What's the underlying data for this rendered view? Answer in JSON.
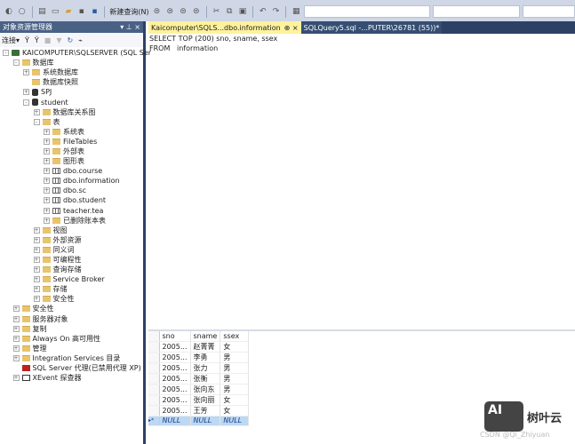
{
  "toolbar": {
    "new_query": "新建查询(N)"
  },
  "object_explorer": {
    "title": "对象资源管理器",
    "pin": "▾ ⊥ ×",
    "connect": "连接▾"
  },
  "tree": [
    {
      "label": "KAICOMPUTER\\SQLSERVER (SQL Ser",
      "level": 0,
      "exp": "-",
      "icon": "srv"
    },
    {
      "label": "数据库",
      "level": 1,
      "exp": "-",
      "icon": "folder"
    },
    {
      "label": "系统数据库",
      "level": 2,
      "exp": "+",
      "icon": "folder"
    },
    {
      "label": "数据库快照",
      "level": 2,
      "exp": "",
      "icon": "folder"
    },
    {
      "label": "SPJ",
      "level": 2,
      "exp": "+",
      "icon": "db"
    },
    {
      "label": "student",
      "level": 2,
      "exp": "-",
      "icon": "db"
    },
    {
      "label": "数据库关系图",
      "level": 3,
      "exp": "+",
      "icon": "folder"
    },
    {
      "label": "表",
      "level": 3,
      "exp": "-",
      "icon": "folder"
    },
    {
      "label": "系统表",
      "level": 4,
      "exp": "+",
      "icon": "folder"
    },
    {
      "label": "FileTables",
      "level": 4,
      "exp": "+",
      "icon": "folder"
    },
    {
      "label": "外部表",
      "level": 4,
      "exp": "+",
      "icon": "folder"
    },
    {
      "label": "图形表",
      "level": 4,
      "exp": "+",
      "icon": "folder"
    },
    {
      "label": "dbo.course",
      "level": 4,
      "exp": "+",
      "icon": "tbl"
    },
    {
      "label": "dbo.information",
      "level": 4,
      "exp": "+",
      "icon": "tbl"
    },
    {
      "label": "dbo.sc",
      "level": 4,
      "exp": "+",
      "icon": "tbl"
    },
    {
      "label": "dbo.student",
      "level": 4,
      "exp": "+",
      "icon": "tbl"
    },
    {
      "label": "teacher.tea",
      "level": 4,
      "exp": "+",
      "icon": "tbl"
    },
    {
      "label": "已删除账本表",
      "level": 4,
      "exp": "+",
      "icon": "folder"
    },
    {
      "label": "视图",
      "level": 3,
      "exp": "+",
      "icon": "folder"
    },
    {
      "label": "外部资源",
      "level": 3,
      "exp": "+",
      "icon": "folder"
    },
    {
      "label": "同义词",
      "level": 3,
      "exp": "+",
      "icon": "folder"
    },
    {
      "label": "可编程性",
      "level": 3,
      "exp": "+",
      "icon": "folder"
    },
    {
      "label": "查询存储",
      "level": 3,
      "exp": "+",
      "icon": "folder"
    },
    {
      "label": "Service Broker",
      "level": 3,
      "exp": "+",
      "icon": "folder"
    },
    {
      "label": "存储",
      "level": 3,
      "exp": "+",
      "icon": "folder"
    },
    {
      "label": "安全性",
      "level": 3,
      "exp": "+",
      "icon": "folder"
    },
    {
      "label": "安全性",
      "level": 1,
      "exp": "+",
      "icon": "folder"
    },
    {
      "label": "服务器对象",
      "level": 1,
      "exp": "+",
      "icon": "folder"
    },
    {
      "label": "复制",
      "level": 1,
      "exp": "+",
      "icon": "folder"
    },
    {
      "label": "Always On 高可用性",
      "level": 1,
      "exp": "+",
      "icon": "folder"
    },
    {
      "label": "管理",
      "level": 1,
      "exp": "+",
      "icon": "folder"
    },
    {
      "label": "Integration Services 目录",
      "level": 1,
      "exp": "+",
      "icon": "folder"
    },
    {
      "label": "SQL Server 代理(已禁用代理 XP)",
      "level": 1,
      "exp": "",
      "icon": "agent"
    },
    {
      "label": "XEvent 探查器",
      "level": 1,
      "exp": "+",
      "icon": "xev"
    }
  ],
  "tabs": {
    "active": "Kaicomputer\\SQLS...dbo.information",
    "active_pin": "⊕ ×",
    "other": "SQLQuery5.sql -...PUTER\\26781 (55))*"
  },
  "editor": {
    "lines": [
      "SELECT TOP (200) sno, sname, ssex",
      "FROM   information"
    ]
  },
  "results": {
    "columns": [
      "sno",
      "sname",
      "ssex"
    ],
    "rows": [
      [
        "2005...",
        "赵菁菁",
        "女"
      ],
      [
        "2005...",
        "李勇",
        "男"
      ],
      [
        "2005...",
        "张力",
        "男"
      ],
      [
        "2005...",
        "张衡",
        "男"
      ],
      [
        "2005...",
        "张向东",
        "男"
      ],
      [
        "2005...",
        "张向丽",
        "女"
      ],
      [
        "2005...",
        "王芳",
        "女"
      ]
    ],
    "new_row": [
      "NULL",
      "NULL",
      "NULL"
    ],
    "new_row_marker": "▸*"
  },
  "watermark": {
    "logo": "AI",
    "brand": "树叶云",
    "credit": "CSDN @Qi_Zhiyuan"
  }
}
